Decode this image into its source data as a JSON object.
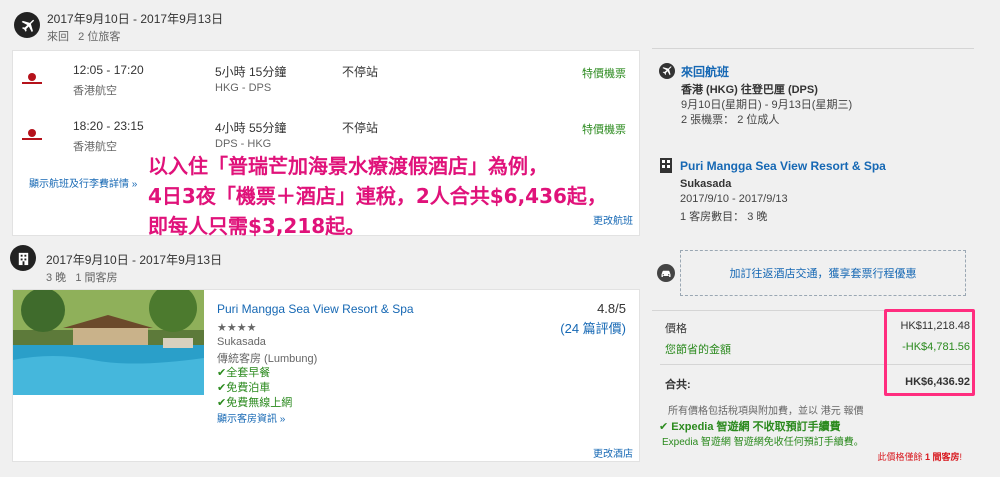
{
  "flight_section": {
    "date_range": "2017年9月10日 - 2017年9月13日",
    "trip_info": "來回   2 位旅客",
    "flights": [
      {
        "time": "12:05 - 17:20",
        "airline": "香港航空",
        "duration": "5小時 15分鐘",
        "route": "HKG - DPS",
        "stops": "不停站",
        "fare": "特價機票"
      },
      {
        "time": "18:20 - 23:15",
        "airline": "香港航空",
        "duration": "4小時 55分鐘",
        "route": "DPS - HKG",
        "stops": "不停站",
        "fare": "特價機票"
      }
    ],
    "details_link": "顯示航班及行李費詳情",
    "change_link": "更改航班"
  },
  "overlay": {
    "line1": "以入住「普瑞芒加海景水療渡假酒店」為例，",
    "line2": "4日3夜「機票＋酒店」連稅，2人合共$6,436起，",
    "line3": "即每人只需$3,218起。"
  },
  "hotel_section": {
    "date_range": "2017年9月10日 - 2017年9月13日",
    "stay_info": "3 晚   1 間客房",
    "name": "Puri Mangga Sea View Resort & Spa",
    "stars": "★★★★",
    "location": "Sukasada",
    "room_type": "傳統客房 (Lumbung)",
    "amenities": [
      "全套早餐",
      "免費泊車",
      "免費無線上網"
    ],
    "room_info_link": "顯示客房資訊",
    "rating": "4.8/5",
    "reviews": "(24 篇評價)",
    "change_link": "更改酒店"
  },
  "summary": {
    "flight_title": "來回航班",
    "flight_route": "香港 (HKG) 往登巴厘 (DPS)",
    "flight_dates": "9月10日(星期日) - 9月13日(星期三)",
    "flight_tickets": "2 張機票： 2 位成人",
    "hotel_title": "Puri Mangga Sea View Resort & Spa",
    "hotel_location": "Sukasada",
    "hotel_dates": "2017/9/10 - 2017/9/13",
    "hotel_rooms": "1 客房數目： 3 晚",
    "transfer_link": "加訂往返酒店交通，獲享套票行程優惠",
    "price_label": "價格",
    "price_value": "HK$11,218.48",
    "savings_label": "您節省的金額",
    "savings_value": "-HK$4,781.56",
    "total_label": "合共:",
    "total_value": "HK$6,436.92",
    "tax_note": "所有價格包括稅項與附加費，並以 港元 報價",
    "no_fee_title": "Expedia 智遊網 不收取預訂手續費",
    "no_fee_note": "Expedia 智遊網 智遊網免收任何預訂手續費。",
    "rooms_left_prefix": "此價格僅餘",
    "rooms_left_count": "1 間客房",
    "rooms_left_suffix": "!"
  },
  "colors": {
    "accent_blue": "#1668b4",
    "green": "#2b8a1e",
    "red": "#d8181e",
    "overlay_pink": "#e0127a",
    "highlight_box": "#ff2d7f"
  }
}
